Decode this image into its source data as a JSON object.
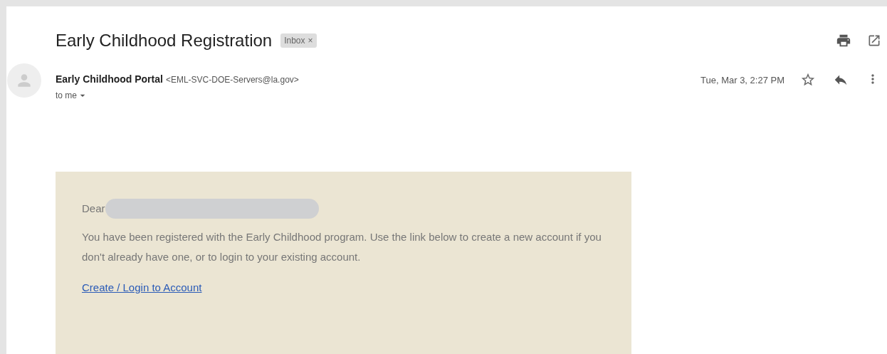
{
  "subject": "Early Childhood Registration",
  "label": {
    "text": "Inbox",
    "close": "×"
  },
  "sender": {
    "name": "Early Childhood Portal",
    "address": "<EML-SVC-DOE-Servers@la.gov>",
    "recipient": "to me",
    "date": "Tue, Mar 3, 2:27 PM",
    "starred": false
  },
  "body": {
    "greeting": "Dear",
    "paragraph": "You have been registered with the Early Childhood program. Use the link below to create a new account if you don't already have one, or to login to your existing account.",
    "link": "Create / Login to Account"
  }
}
